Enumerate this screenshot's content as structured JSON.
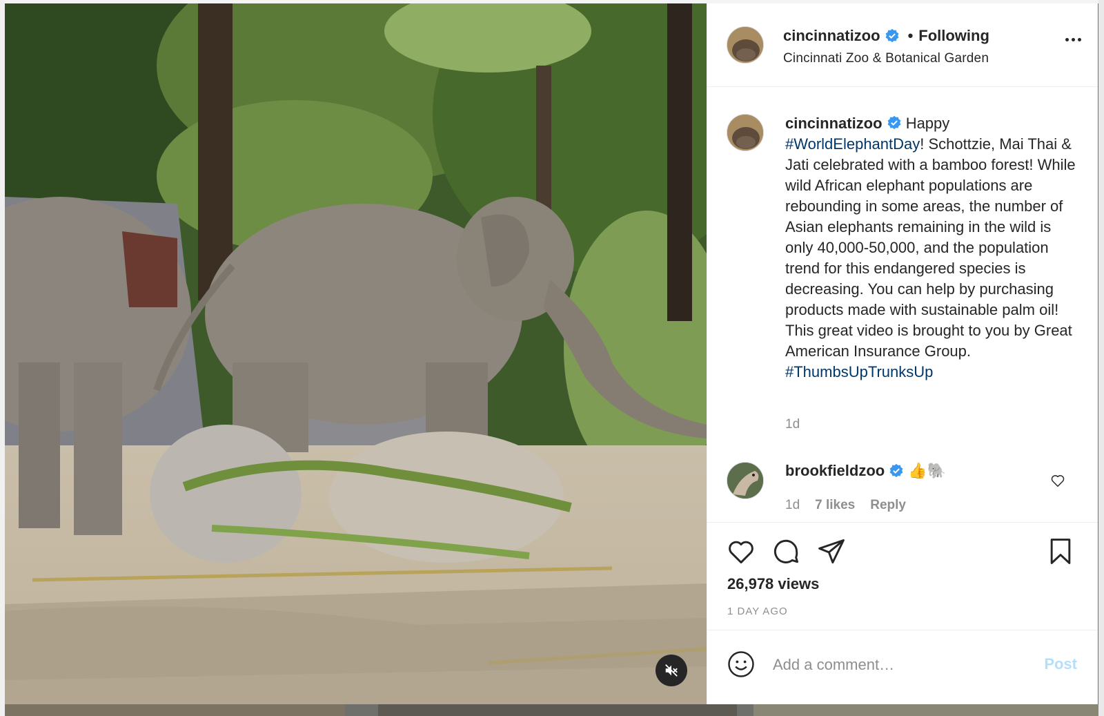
{
  "post": {
    "username": "cincinnatizoo",
    "separator": "•",
    "follow_status": "Following",
    "location": "Cincinnati Zoo & Botanical Garden",
    "caption": {
      "text_1": "Happy",
      "hashtag_1": "#WorldElephantDay",
      "text_2": "! Schottzie, Mai Thai & Jati celebrated with a bamboo forest! While wild African elephant populations are rebounding in some areas, the number of Asian elephants remaining in the wild is only 40,000-50,000, and the population trend for this endangered species is decreasing. You can help by purchasing products made with sustainable palm oil! This great video is brought to you by Great American Insurance Group.",
      "hashtag_2": "#ThumbsUpTrunksUp",
      "time": "1d"
    },
    "comment": {
      "username": "brookfieldzoo",
      "text": "👍🐘",
      "time": "1d",
      "likes": "7 likes",
      "reply_label": "Reply"
    },
    "views": "26,978 views",
    "posted_ago": "1 DAY AGO",
    "add_comment": {
      "placeholder": "Add a comment…",
      "post_label": "Post"
    }
  },
  "icons": {
    "verified": "verified-badge-icon",
    "more": "more-options-icon",
    "like": "heart-icon",
    "comment": "comment-icon",
    "share": "share-icon",
    "save": "bookmark-icon",
    "emoji": "emoji-icon",
    "mute": "muted-audio-icon"
  },
  "colors": {
    "verified": "#3897f0",
    "hashtag": "#00376b",
    "post_disabled": "#b2dffc",
    "secondary_text": "#8e8e8e"
  }
}
